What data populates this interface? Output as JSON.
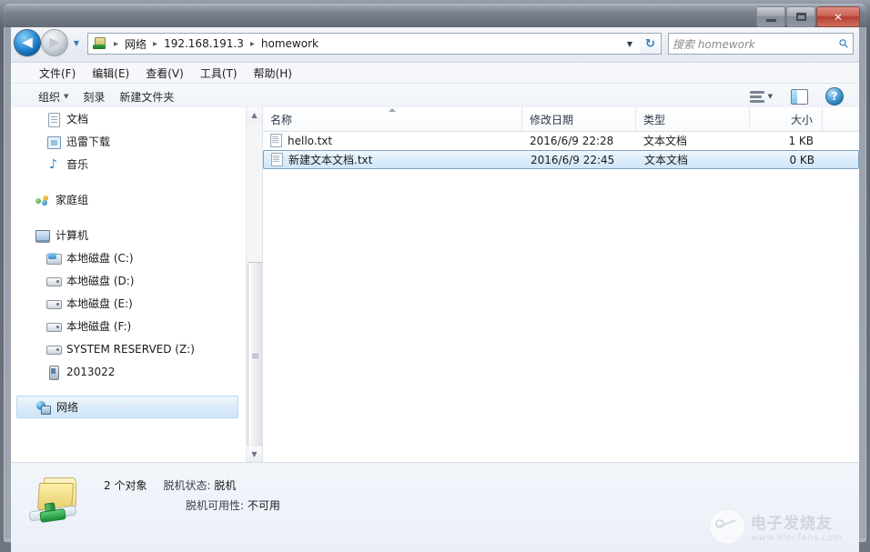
{
  "window": {
    "title": "",
    "caption_buttons": [
      {
        "name": "minimize",
        "label": "–"
      },
      {
        "name": "maximize",
        "label": "□"
      },
      {
        "name": "close",
        "label": "✕"
      }
    ]
  },
  "navigation": {
    "back_label": "◀",
    "forward_label": "▶",
    "history_label": "▼",
    "refresh_label": "↻"
  },
  "breadcrumb": {
    "icon": "network-computer-icon",
    "separator": "▸",
    "segments": [
      "网络",
      "192.168.191.3",
      "homework"
    ],
    "dropdown_label": "▼"
  },
  "search": {
    "placeholder": "搜索 homework",
    "icon": "search-icon",
    "value": ""
  },
  "menubar": {
    "items": [
      {
        "label": "文件(F)"
      },
      {
        "label": "编辑(E)"
      },
      {
        "label": "查看(V)"
      },
      {
        "label": "工具(T)"
      },
      {
        "label": "帮助(H)"
      }
    ]
  },
  "toolbar": {
    "organize_label": "组织",
    "organize_caret": "▼",
    "burn_label": "刻录",
    "new_folder_label": "新建文件夹",
    "view_caret": "▼",
    "help_label": "?"
  },
  "navpane": {
    "scroll_up": "▲",
    "scroll_down": "▼",
    "items": [
      {
        "label": "文档",
        "icon": "document-icon",
        "indent": true,
        "selected": false
      },
      {
        "label": "迅雷下载",
        "icon": "download-icon",
        "indent": true,
        "selected": false
      },
      {
        "label": "音乐",
        "icon": "music-icon",
        "indent": true,
        "selected": false
      },
      {
        "label": "家庭组",
        "icon": "homegroup-icon",
        "indent": false,
        "selected": false
      },
      {
        "label": "计算机",
        "icon": "computer-icon",
        "indent": false,
        "selected": false
      },
      {
        "label": "本地磁盘 (C:)",
        "icon": "system-drive-icon",
        "indent": true,
        "selected": false
      },
      {
        "label": "本地磁盘 (D:)",
        "icon": "drive-icon",
        "indent": true,
        "selected": false
      },
      {
        "label": "本地磁盘 (E:)",
        "icon": "drive-icon",
        "indent": true,
        "selected": false
      },
      {
        "label": "本地磁盘 (F:)",
        "icon": "drive-icon",
        "indent": true,
        "selected": false
      },
      {
        "label": "SYSTEM RESERVED (Z:)",
        "icon": "drive-icon",
        "indent": true,
        "selected": false
      },
      {
        "label": "2013022",
        "icon": "portable-device-icon",
        "indent": true,
        "selected": false
      },
      {
        "label": "网络",
        "icon": "network-icon",
        "indent": false,
        "selected": true
      }
    ]
  },
  "filelist": {
    "columns": [
      {
        "key": "name",
        "label": "名称",
        "sorted": "asc"
      },
      {
        "key": "date",
        "label": "修改日期",
        "sorted": ""
      },
      {
        "key": "type",
        "label": "类型",
        "sorted": ""
      },
      {
        "key": "size",
        "label": "大小",
        "sorted": ""
      }
    ],
    "rows": [
      {
        "icon": "text-file-icon",
        "name": "hello.txt",
        "date": "2016/6/9 22:28",
        "type": "文本文档",
        "size": "1 KB",
        "selected": false
      },
      {
        "icon": "text-file-icon",
        "name": "新建文本文档.txt",
        "date": "2016/6/9 22:45",
        "type": "文本文档",
        "size": "0 KB",
        "selected": true
      }
    ]
  },
  "statusbar": {
    "icon": "shared-folder-icon",
    "item_count": "2 个对象",
    "offline_status_label": "脱机状态:",
    "offline_status_value": "脱机",
    "offline_availability_label": "脱机可用性:",
    "offline_availability_value": "不可用"
  },
  "watermark": {
    "cn": "电子发烧友",
    "en": "www.elecfans.com"
  },
  "colors": {
    "selection": "#cfe6fa",
    "selection_border": "#7da2c4",
    "close_button": "#b93020",
    "accent_blue": "#2a7fbd"
  }
}
